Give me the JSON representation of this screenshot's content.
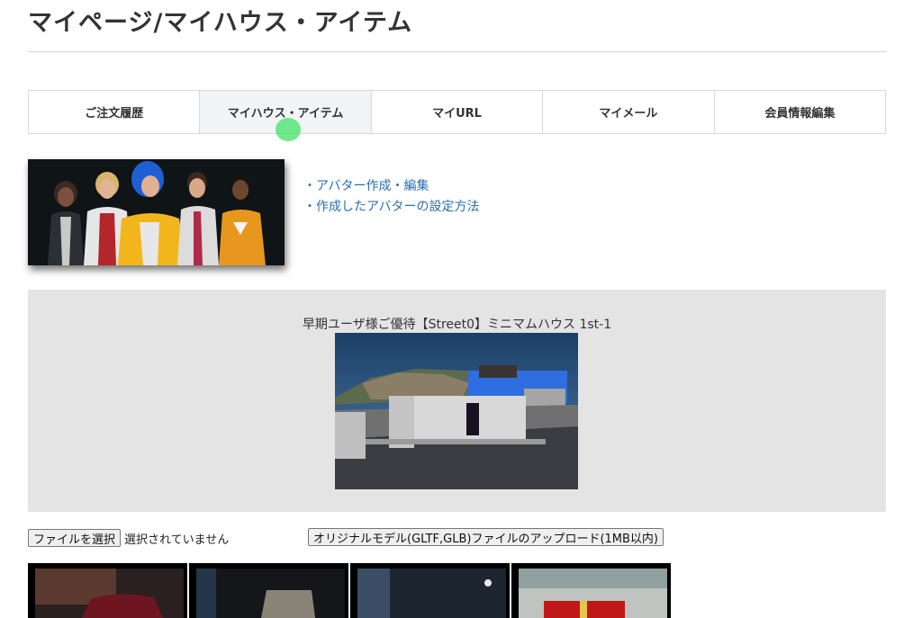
{
  "page": {
    "title": "マイページ/マイハウス・アイテム"
  },
  "tabs": [
    {
      "label": "ご注文履歴",
      "active": false
    },
    {
      "label": "マイハウス・アイテム",
      "active": true
    },
    {
      "label": "マイURL",
      "active": false
    },
    {
      "label": "マイメール",
      "active": false
    },
    {
      "label": "会員情報編集",
      "active": false
    }
  ],
  "links": [
    {
      "label": "・アバター作成・編集"
    },
    {
      "label": "・作成したアバターの設定方法"
    }
  ],
  "featured": {
    "title": "早期ユーザ様ご優待【Street0】ミニマムハウス 1st-1"
  },
  "upload": {
    "choose_file_label": "ファイルを選択",
    "file_status": "選択されていません",
    "upload_button_label": "オリジナルモデル(GLTF,GLB)ファイルのアップロード(1MB以内)"
  },
  "colors": {
    "link": "#2a6fb0",
    "active_tab_bg": "#f2f4f5",
    "feature_bg": "#e4e4e4",
    "cursor_highlight": "#58e478"
  }
}
